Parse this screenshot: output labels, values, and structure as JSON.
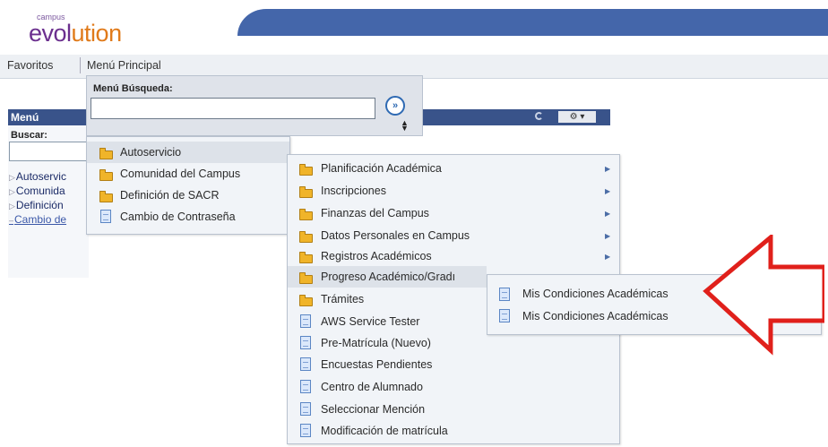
{
  "logo": {
    "small": "campus",
    "big_part1": "evol",
    "big_part2": "ution"
  },
  "nav": {
    "favoritos": "Favoritos",
    "menu_principal": "Menú Principal"
  },
  "portlet": {
    "title": "Menú",
    "buscar_label": "Buscar:",
    "settings_label": "⚙ ▾",
    "links": [
      {
        "label": "Autoservicio",
        "clipped": "Autoservic"
      },
      {
        "label": "Comunidad del Campus",
        "clipped": "Comunida"
      },
      {
        "label": "Definición de SACR",
        "clipped": "Definición"
      },
      {
        "label": "Cambio de Contraseña",
        "clipped": "Cambio de"
      }
    ]
  },
  "search": {
    "label": "Menú Búsqueda:",
    "value": "",
    "go_label": "»",
    "sort_symbol": "▲▼"
  },
  "menu1": [
    {
      "label": "Autoservicio",
      "icon": "folder-icon"
    },
    {
      "label": "Comunidad del Campus",
      "icon": "folder-icon"
    },
    {
      "label": "Definición de SACR",
      "icon": "folder-icon"
    },
    {
      "label": "Cambio de Contraseña",
      "icon": "page-icon"
    }
  ],
  "menu2": [
    {
      "label": "Planificación Académica",
      "icon": "folder-icon",
      "submenu": true
    },
    {
      "label": "Inscripciones",
      "icon": "folder-icon",
      "submenu": true
    },
    {
      "label": "Finanzas del Campus",
      "icon": "folder-icon",
      "submenu": true
    },
    {
      "label": "Datos Personales en Campus",
      "icon": "folder-icon",
      "submenu": true
    },
    {
      "label": "Registros Académicos",
      "icon": "folder-icon",
      "submenu": true
    },
    {
      "label": "Progreso Académico/Gradı",
      "icon": "folder-icon",
      "submenu": false
    },
    {
      "label": "Trámites",
      "icon": "folder-icon",
      "submenu": false
    },
    {
      "label": "AWS Service Tester",
      "icon": "page-icon",
      "submenu": false
    },
    {
      "label": "Pre-Matrícula (Nuevo)",
      "icon": "page-icon",
      "submenu": false
    },
    {
      "label": "Encuestas Pendientes",
      "icon": "page-icon",
      "submenu": false
    },
    {
      "label": "Centro de Alumnado",
      "icon": "page-icon",
      "submenu": false
    },
    {
      "label": "Seleccionar Mención",
      "icon": "page-icon",
      "submenu": false
    },
    {
      "label": "Modificación de matrícula",
      "icon": "page-icon",
      "submenu": false
    }
  ],
  "menu3": [
    {
      "label": "Mis Condiciones Académicas",
      "icon": "page-icon"
    },
    {
      "label": "Mis Condiciones Académicas",
      "icon": "page-icon"
    }
  ],
  "colors": {
    "banner": "#4466aa",
    "portlet_header": "#39538a",
    "folder": "#f0b429",
    "callout_arrow": "#e0201b"
  }
}
